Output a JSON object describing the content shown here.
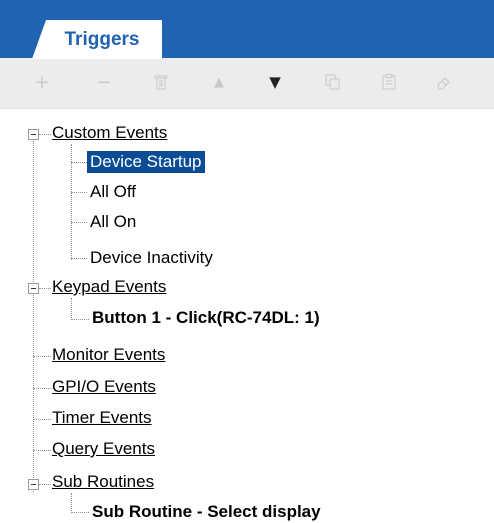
{
  "tabs": [
    {
      "label": "Triggers"
    }
  ],
  "toolbar": {
    "buttons": [
      {
        "name": "add",
        "icon": "plus-icon",
        "glyph": "+",
        "enabled": false
      },
      {
        "name": "remove",
        "icon": "minus-icon",
        "glyph": "−",
        "enabled": false
      },
      {
        "name": "delete",
        "icon": "trash-icon",
        "glyph": "🗑",
        "enabled": false
      },
      {
        "name": "move-up",
        "icon": "triangle-up-icon",
        "glyph": "▲",
        "enabled": false
      },
      {
        "name": "move-down",
        "icon": "triangle-down-icon",
        "glyph": "▼",
        "enabled": true
      },
      {
        "name": "copy",
        "icon": "copy-icon",
        "glyph": "⧉",
        "enabled": false
      },
      {
        "name": "paste",
        "icon": "clipboard-icon",
        "glyph": "📋",
        "enabled": false
      },
      {
        "name": "edit",
        "icon": "eraser-icon",
        "glyph": "✎",
        "enabled": false
      }
    ]
  },
  "tree": {
    "custom_events": {
      "label": "Custom Events",
      "children": [
        "Device Startup",
        "All Off",
        "All On",
        "Device Inactivity"
      ],
      "selected": "Device Startup"
    },
    "keypad_events": {
      "label": "Keypad Events",
      "children": [
        "Button 1 - Click(RC-74DL: 1)"
      ]
    },
    "monitor_events": "Monitor Events",
    "gpio_events": "GPI/O Events",
    "timer_events": "Timer Events",
    "query_events": "Query Events",
    "sub_routines": {
      "label": "Sub Routines",
      "children": [
        "Sub Routine - Select display"
      ]
    }
  },
  "colors": {
    "tab_bar": "#1f63b2",
    "selection": "#0a4d96",
    "toolbar": "#ececec"
  }
}
